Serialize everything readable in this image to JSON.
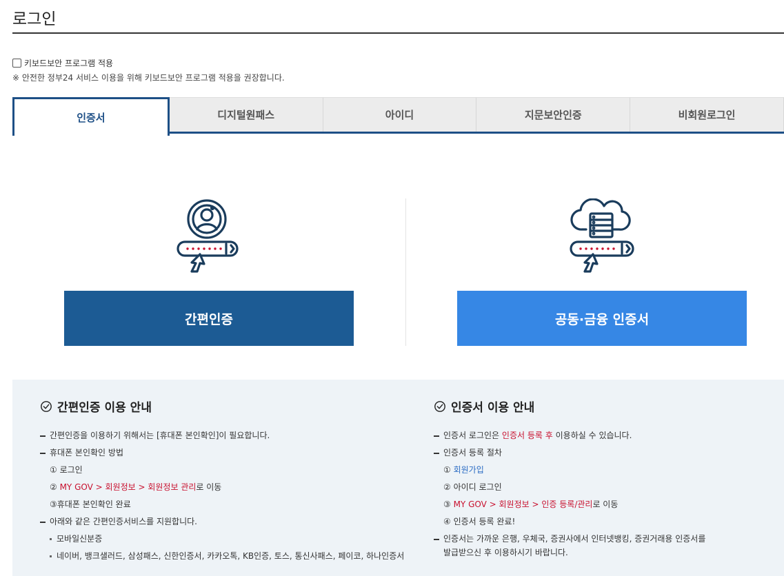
{
  "page": {
    "title": "로그인"
  },
  "keyboard_security": {
    "checkbox_label": "키보드보안 프로그램 적용",
    "note": "※ 안전한 정부24 서비스 이용을 위해 키보드보안 프로그램 적용을 권장합니다."
  },
  "tabs": [
    {
      "label": "인증서",
      "active": true
    },
    {
      "label": "디지털원패스"
    },
    {
      "label": "아이디"
    },
    {
      "label": "지문보안인증"
    },
    {
      "label": "비회원로그인"
    }
  ],
  "buttons": {
    "easy_auth": "간편인증",
    "joint_cert": "공동·금융 인증서"
  },
  "icons": {
    "easy_auth": "user-password-icon",
    "joint_cert": "cloud-server-password-icon"
  },
  "colors": {
    "primary_dark": "#1c5b94",
    "primary_light": "#3687e5",
    "accent_red": "#c8102e",
    "link_blue": "#2b6cc4"
  },
  "guide_easy": {
    "heading": "간편인증 이용 안내",
    "line1": "간편인증을 이용하기 위해서는 [휴대폰 본인확인]이 필요합니다.",
    "line2": "휴대폰 본인확인 방법",
    "step1": "① 로그인",
    "step2_prefix": "② ",
    "step2_red": "MY GOV > 회원정보 > 회원정보 관리",
    "step2_suffix": "로 이동",
    "step3": "③휴대폰 본인확인 완료",
    "line3": "아래와 같은 간편인증서비스를 지원합니다.",
    "bullet1": "모바일신분증",
    "bullet2": "네이버, 뱅크샐러드, 삼성패스, 신한인증서, 카카오톡, KB인증, 토스, 통신사패스, 페이코, 하나인증서"
  },
  "guide_cert": {
    "heading": "인증서 이용 안내",
    "line1_prefix": "인증서 로그인은 ",
    "line1_red": "인증서 등록 후",
    "line1_suffix": " 이용하실 수 있습니다.",
    "line2": "인증서 등록 절차",
    "step1_prefix": "① ",
    "step1_link": "회원가입",
    "step2": "② 아이디 로그인",
    "step3_prefix": "③ ",
    "step3_red": "MY GOV > 회원정보 > 인증 등록/관리",
    "step3_suffix": "로 이동",
    "step4": "④ 인증서 등록 완료!",
    "line3a": "인증서는 가까운 은행, 우체국, 증권사에서 인터넷뱅킹, 증권거래용 인증서를",
    "line3b": "발급받으신 후 이용하시기 바랍니다."
  }
}
